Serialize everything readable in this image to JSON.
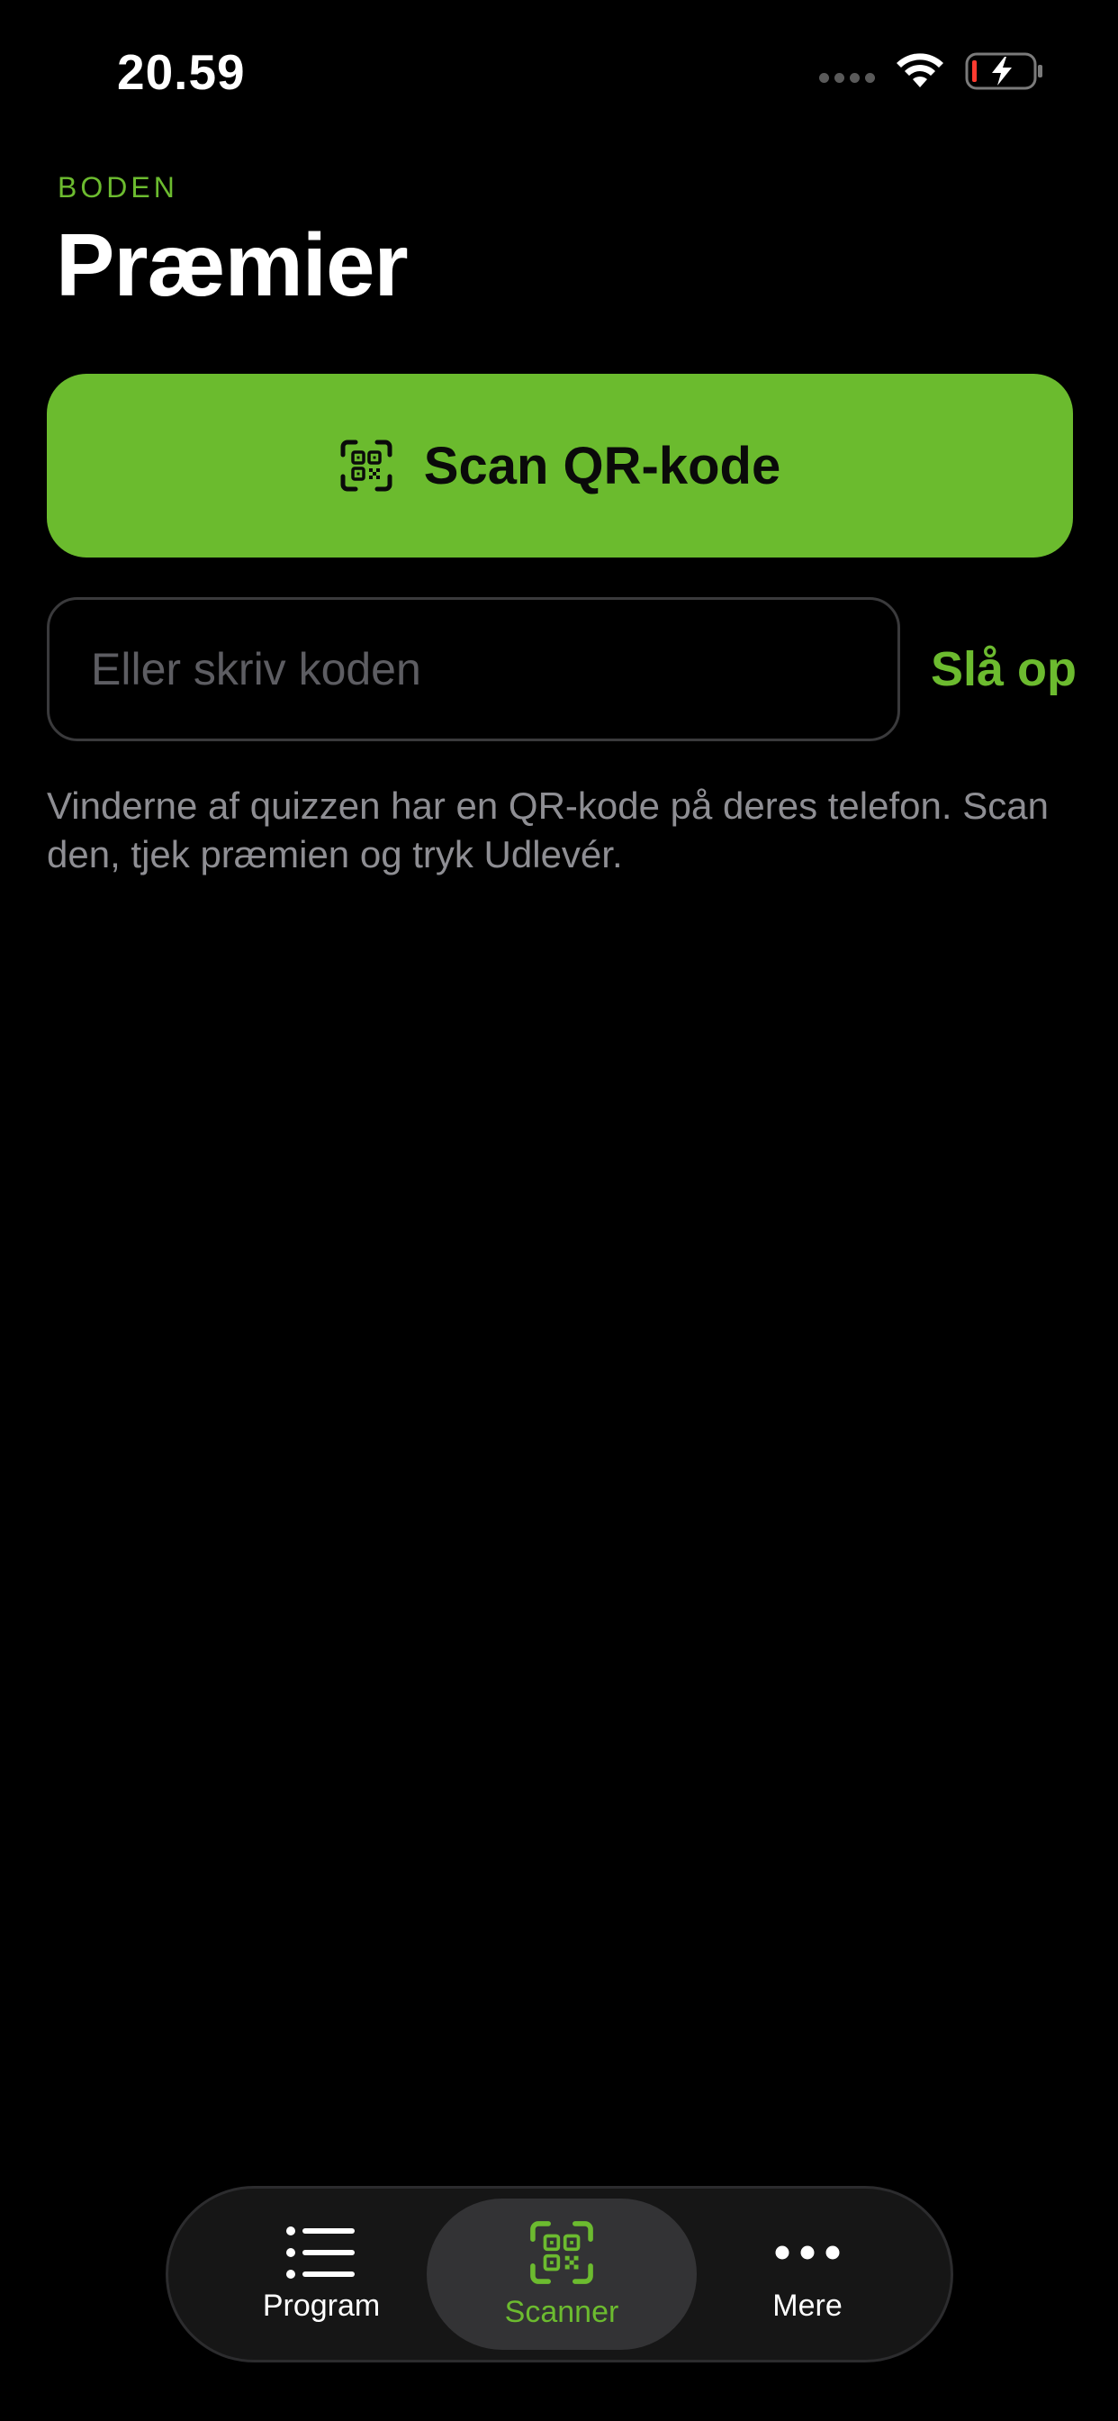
{
  "status_bar": {
    "time": "20.59",
    "icons": [
      "cellular-signal-icon",
      "wifi-icon",
      "battery-charging-icon"
    ]
  },
  "header": {
    "eyebrow": "BODEN",
    "title": "Præmier"
  },
  "scan_button": {
    "label": "Scan QR-kode",
    "icon": "qr-scan-icon"
  },
  "code_entry": {
    "placeholder": "Eller skriv koden",
    "value": "",
    "lookup_label": "Slå op"
  },
  "help_text": "Vinderne af quizzen har en QR-kode på deres telefon. Scan den, tjek præmien og tryk Udlevér.",
  "tab_bar": {
    "selected": "scanner",
    "tabs": [
      {
        "id": "program",
        "label": "Program",
        "icon": "list-icon"
      },
      {
        "id": "scanner",
        "label": "Scanner",
        "icon": "qr-scan-icon"
      },
      {
        "id": "mere",
        "label": "Mere",
        "icon": "more-dots-icon"
      }
    ]
  },
  "colors": {
    "accent": "#6BBB2E",
    "background": "#000000",
    "secondary_text": "#8E8E93",
    "tab_bar_bg": "#161616",
    "selected_tab_bg": "#333335"
  }
}
